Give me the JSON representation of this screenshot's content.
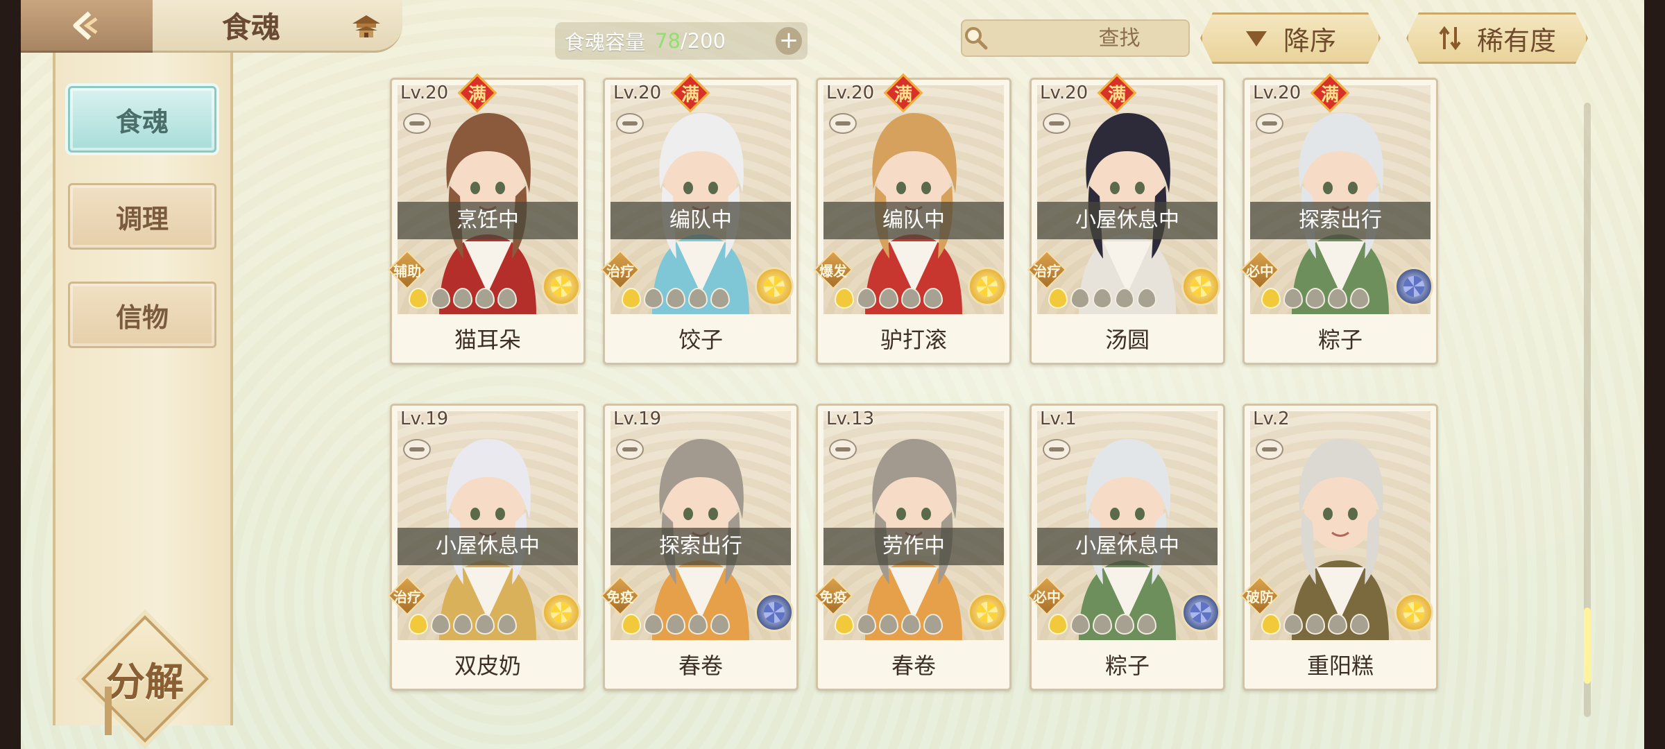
{
  "header": {
    "title": "食魂",
    "capacity_label": "食魂容量",
    "capacity_current": "78",
    "capacity_max": "/200",
    "search_placeholder": "查找",
    "sort_order_label": "降序",
    "sort_key_label": "稀有度"
  },
  "sidebar": {
    "items": [
      {
        "label": "食魂",
        "active": true
      },
      {
        "label": "调理",
        "active": false
      },
      {
        "label": "信物",
        "active": false
      }
    ],
    "decompose_label": "分解"
  },
  "cards": [
    {
      "level": "Lv.20",
      "max": "满",
      "status": "烹饪中",
      "role": "辅助",
      "name": "猫耳朵",
      "rarity": "gold",
      "flames_lit": 1,
      "hair": "#8b5a3c",
      "outfit": "#b42f2a"
    },
    {
      "level": "Lv.20",
      "max": "满",
      "status": "编队中",
      "role": "治疗",
      "name": "饺子",
      "rarity": "gold",
      "flames_lit": 1,
      "hair": "#eeeeee",
      "outfit": "#7fc7d6"
    },
    {
      "level": "Lv.20",
      "max": "满",
      "status": "编队中",
      "role": "爆发",
      "name": "驴打滚",
      "rarity": "gold",
      "flames_lit": 1,
      "hair": "#d6a15d",
      "outfit": "#c8372f"
    },
    {
      "level": "Lv.20",
      "max": "满",
      "status": "小屋休息中",
      "role": "治疗",
      "name": "汤圆",
      "rarity": "gold",
      "flames_lit": 1,
      "hair": "#2d2a3a",
      "outfit": "#e7e2da"
    },
    {
      "level": "Lv.20",
      "max": "满",
      "status": "探索出行",
      "role": "必中",
      "name": "粽子",
      "rarity": "blue",
      "flames_lit": 1,
      "hair": "#e3e6e8",
      "outfit": "#6d8f5c"
    },
    {
      "level": "Lv.19",
      "max": "",
      "status": "小屋休息中",
      "role": "治疗",
      "name": "双皮奶",
      "rarity": "gold",
      "flames_lit": 1,
      "hair": "#e9e9ef",
      "outfit": "#d9b15a"
    },
    {
      "level": "Lv.19",
      "max": "",
      "status": "探索出行",
      "role": "免疫",
      "name": "春卷",
      "rarity": "blue",
      "flames_lit": 1,
      "hair": "#a39a8f",
      "outfit": "#e6a04a"
    },
    {
      "level": "Lv.13",
      "max": "",
      "status": "劳作中",
      "role": "免疫",
      "name": "春卷",
      "rarity": "gold",
      "flames_lit": 1,
      "hair": "#a39a8f",
      "outfit": "#e6a04a"
    },
    {
      "level": "Lv.1",
      "max": "",
      "status": "小屋休息中",
      "role": "必中",
      "name": "粽子",
      "rarity": "blue",
      "flames_lit": 1,
      "hair": "#e3e6e8",
      "outfit": "#6d8f5c"
    },
    {
      "level": "Lv.2",
      "max": "",
      "status": "",
      "role": "破防",
      "name": "重阳糕",
      "rarity": "gold",
      "flames_lit": 1,
      "hair": "#dcd8d2",
      "outfit": "#7b6a3e"
    }
  ],
  "colors": {
    "accent_teal": "#a7ddd9",
    "capacity_current": "#8fe06e",
    "max_badge": "#d7312a",
    "scroll_thumb": "#fff3a0"
  },
  "scroll": {
    "position_fraction": 0.82,
    "visible_fraction": 0.12
  }
}
